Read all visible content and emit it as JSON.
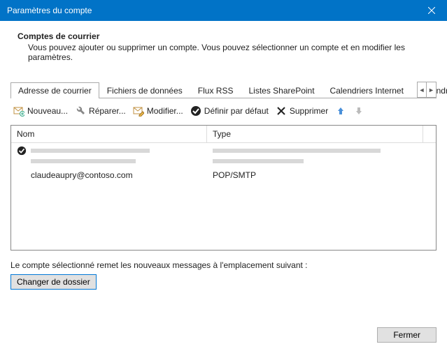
{
  "window": {
    "title": "Paramètres du compte"
  },
  "section": {
    "title": "Comptes de courrier",
    "description": "Vous pouvez ajouter ou supprimer un compte. Vous pouvez sélectionner un compte et en modifier les paramètres."
  },
  "tabs": {
    "t0": "Adresse de courrier",
    "t1": "Fichiers de données",
    "t2": "Flux RSS",
    "t3": "Listes SharePoint",
    "t4": "Calendriers Internet",
    "t5": "Calendriers publi"
  },
  "toolbar": {
    "new": "Nouveau...",
    "repair": "Réparer...",
    "modify": "Modifier...",
    "default": "Définir par défaut",
    "delete": "Supprimer"
  },
  "list": {
    "col_name": "Nom",
    "col_type": "Type",
    "account_email": "claudeaupry@contoso.com",
    "account_type": "POP/SMTP"
  },
  "delivery": {
    "text": "Le compte sélectionné remet les nouveaux messages à l'emplacement suivant :",
    "button": "Changer de dossier"
  },
  "footer": {
    "close": "Fermer"
  }
}
